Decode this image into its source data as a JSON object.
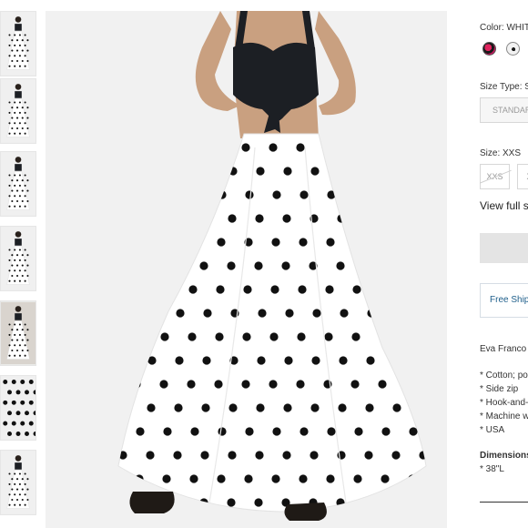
{
  "product": {
    "color_label": "Color: WHITE",
    "color_swatches": [
      {
        "name": "pink-black",
        "fill": "#c2185b",
        "accent": "#1a1a1a"
      },
      {
        "name": "white-polka",
        "fill": "#f2f2f2",
        "accent": "#1a1a1a"
      }
    ],
    "size_type_label": "Size Type: Standard",
    "size_type_option": "STANDARD",
    "size_label": "Size: XXS",
    "size_options": [
      "XXS",
      "XS"
    ],
    "size_guide_link": "View full size guide",
    "shipping_text": "Free Shipping",
    "brand_line": "Eva Franco",
    "details": [
      "* Cotton; polyester",
      "* Side zip",
      "* Hook-and-eye",
      "* Machine wash",
      "* USA"
    ],
    "dimensions_heading": "Dimensions",
    "dimensions": [
      "* 38\"L"
    ]
  },
  "colors": {
    "dot": "#111111",
    "skirt": "#ffffff",
    "top": "#1c1f24",
    "skin": "#c9a080",
    "background": "#f1f1f1"
  }
}
